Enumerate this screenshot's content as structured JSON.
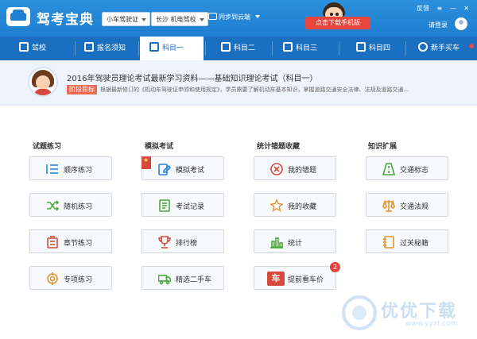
{
  "app": {
    "title": "驾考宝典"
  },
  "header": {
    "license_select": "小车驾驶证",
    "school_select": "长沙 机电驾校",
    "sync_label": "同步到云端",
    "download_button": "点击下载手机版",
    "feedback": "反馈",
    "login": "请登录"
  },
  "nav": {
    "items": [
      {
        "label": "驾校",
        "icon": "home-icon"
      },
      {
        "label": "报名须知",
        "icon": "document-icon"
      },
      {
        "label": "科目一",
        "icon": "edit-icon",
        "active": true
      },
      {
        "label": "科目二",
        "icon": "cone-icon"
      },
      {
        "label": "科目三",
        "icon": "car-icon"
      },
      {
        "label": "科目四",
        "icon": "book-icon"
      },
      {
        "label": "新手买车",
        "icon": "steering-wheel-icon"
      }
    ]
  },
  "banner": {
    "title": "2016年驾驶员理论考试最新学习资料——基础知识理论考试（科目一）",
    "tag": "阶段目标",
    "description": "根据最新修订的《机动车驾驶证申领和使用规定》，学员需要了解机动车基本知识，掌握道路交通安全法律、法规及道路交通..."
  },
  "sections": [
    {
      "title": "试题练习",
      "buttons": [
        "顺序练习",
        "随机练习",
        "章节练习",
        "专项练习"
      ]
    },
    {
      "title": "模拟考试",
      "buttons": [
        "模拟考试",
        "考试记录",
        "排行榜",
        "精选二手车"
      ]
    },
    {
      "title": "统计错题收藏",
      "buttons": [
        "我的错题",
        "我的收藏",
        "统计",
        "提前看车价"
      ]
    },
    {
      "title": "知识扩展",
      "buttons": [
        "交通标志",
        "交通法规",
        "过关秘籍"
      ]
    }
  ],
  "badges": {
    "car_price": "2"
  },
  "watermark": {
    "text": "优优下载",
    "url": "www.yyxt.com"
  },
  "colors": {
    "primary": "#1f7fd0",
    "nav": "#1a6fc0",
    "accent_red": "#e8463c"
  }
}
